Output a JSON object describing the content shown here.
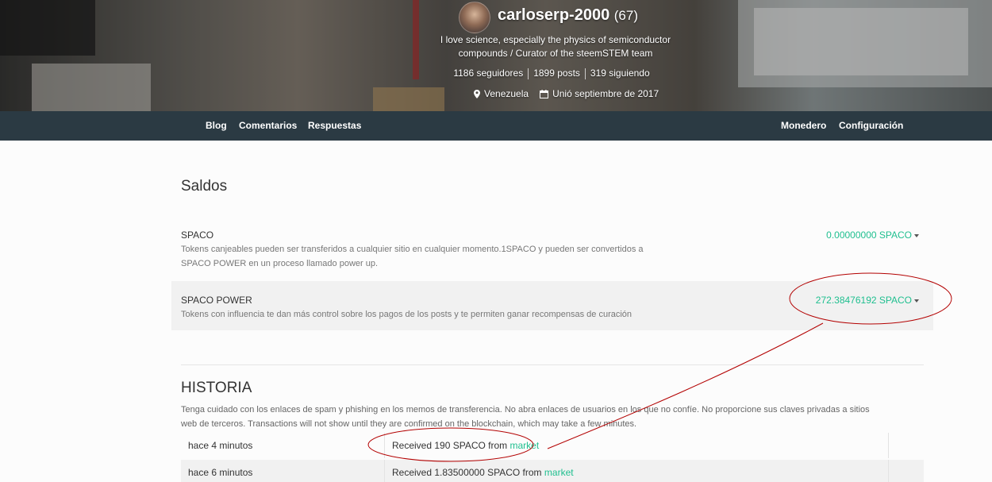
{
  "profile": {
    "username": "carloserp-2000",
    "reputation": "(67)",
    "bio": "I love science, especially the physics of semiconductor compounds / Curator of the steemSTEM team",
    "followers": "1186 seguidores",
    "posts": "1899 posts",
    "following": "319 siguiendo",
    "location": "Venezuela",
    "joined": "Unió septiembre de 2017"
  },
  "nav": {
    "left": [
      "Blog",
      "Comentarios",
      "Respuestas"
    ],
    "right": [
      "Monedero",
      "Configuración"
    ]
  },
  "balances": {
    "heading": "Saldos",
    "spaco": {
      "title": "SPACO",
      "description": "Tokens canjeables pueden ser transferidos a cualquier sitio en cualquier momento.1SPACO y pueden ser convertidos a SPACO POWER en un proceso llamado power up.",
      "amount": "0.00000000 SPACO"
    },
    "power": {
      "title": "SPACO POWER",
      "description": "Tokens con influencia te dan más control sobre los pagos de los posts y te permiten ganar recompensas de curación",
      "amount": "272.38476192 SPACO"
    }
  },
  "history": {
    "heading": "HISTORIA",
    "note": "Tenga cuidado con los enlaces de spam y phishing en los memos de transferencia. No abra enlaces de usuarios en los que no confíe. No proporcione sus claves privadas a sitios web de terceros. Transactions will not show until they are confirmed on the blockchain, which may take a few minutes.",
    "rows": [
      {
        "when": "hace 4 minutos",
        "text": "Received 190 SPACO from",
        "link": "market"
      },
      {
        "when": "hace 6 minutos",
        "text": "Received 1.83500000 SPACO from",
        "link": "market"
      }
    ]
  },
  "colors": {
    "accent": "#1fbf8f",
    "nav_bg": "#2b3a43",
    "annotation": "#b30000"
  },
  "icons": [
    "map-pin-icon",
    "calendar-icon",
    "caret-down-icon"
  ]
}
